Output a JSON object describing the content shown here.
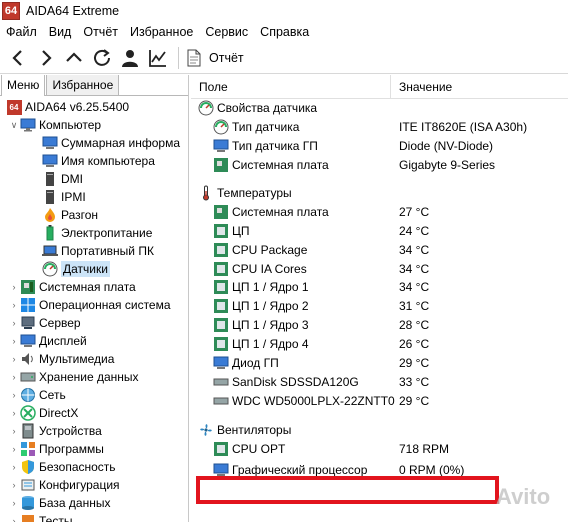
{
  "window": {
    "title": "AIDA64 Extreme",
    "app_icon_text": "64"
  },
  "menu": [
    "Файл",
    "Вид",
    "Отчёт",
    "Избранное",
    "Сервис",
    "Справка"
  ],
  "toolbar": {
    "report_label": "Отчёт"
  },
  "tabs": {
    "menu": "Меню",
    "favorites": "Избранное"
  },
  "tree": {
    "root": "AIDA64 v6.25.5400",
    "computer": "Компьютер",
    "computer_children": [
      "Суммарная информа",
      "Имя компьютера",
      "DMI",
      "IPMI",
      "Разгон",
      "Электропитание",
      "Портативный ПК",
      "Датчики"
    ],
    "sections": [
      "Системная плата",
      "Операционная система",
      "Сервер",
      "Дисплей",
      "Мультимедиа",
      "Хранение данных",
      "Сеть",
      "DirectX",
      "Устройства",
      "Программы",
      "Безопасность",
      "Конфигурация",
      "База данных",
      "Тесты"
    ]
  },
  "columns": {
    "field": "Поле",
    "value": "Значение"
  },
  "sensor_props": {
    "title": "Свойства датчика",
    "rows": [
      {
        "field": "Тип датчика",
        "value": "ITE IT8620E  (ISA A30h)"
      },
      {
        "field": "Тип датчика ГП",
        "value": "Diode  (NV-Diode)"
      },
      {
        "field": "Системная плата",
        "value": "Gigabyte 9-Series"
      }
    ]
  },
  "temperatures": {
    "title": "Температуры",
    "rows": [
      {
        "field": "Системная плата",
        "value": "27 °C"
      },
      {
        "field": "ЦП",
        "value": "24 °C"
      },
      {
        "field": "CPU Package",
        "value": "34 °C"
      },
      {
        "field": "CPU IA Cores",
        "value": "34 °C"
      },
      {
        "field": "ЦП 1 / Ядро 1",
        "value": "34 °C"
      },
      {
        "field": "ЦП 1 / Ядро 2",
        "value": "31 °C"
      },
      {
        "field": "ЦП 1 / Ядро 3",
        "value": "28 °C"
      },
      {
        "field": "ЦП 1 / Ядро 4",
        "value": "26 °C"
      },
      {
        "field": "Диод ГП",
        "value": "29 °C"
      },
      {
        "field": "SanDisk SDSSDA120G",
        "value": "33 °C"
      },
      {
        "field": "WDC WD5000LPLX-22ZNTT0",
        "value": "29 °C"
      }
    ]
  },
  "fans": {
    "title": "Вентиляторы",
    "rows": [
      {
        "field": "CPU OPT",
        "value": "718 RPM"
      },
      {
        "field": "Графический процессор",
        "value": "0 RPM  (0%)"
      }
    ]
  },
  "watermark": "Avito",
  "colors": {
    "highlight": "#e2141d",
    "selection": "#cce4f7"
  }
}
